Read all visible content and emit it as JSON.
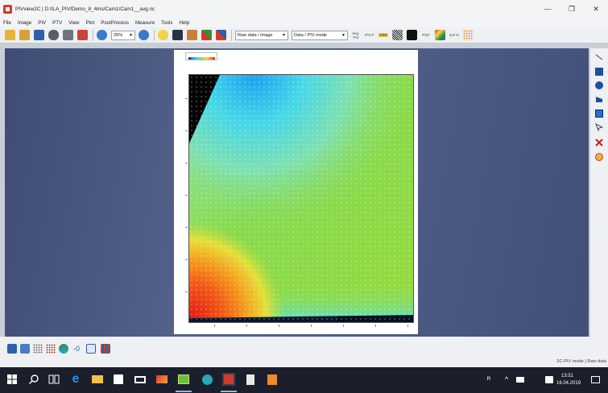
{
  "window": {
    "title": "PIVview2C | D:/ILA_PIV/Demo_8_4ms/Cam1/Cam1__avg.nc",
    "minimize": "—",
    "maximize": "❐",
    "close": "✕"
  },
  "menu": {
    "items": [
      "File",
      "Image",
      "PIV",
      "PTV",
      "View",
      "Plot",
      "PostProcess",
      "Measure",
      "Tools",
      "Help"
    ]
  },
  "toolbar": {
    "zoom_value": "25%",
    "display_mode": "Raw data / image",
    "data_mode": "Data / PIV mode",
    "img_pre_label": "Img-Pre",
    "pivf_label": "PIV-F",
    "cfg_label": "CFG",
    "pdf_label": "PDF",
    "zn_label": "Σu² N",
    "caret": "▼"
  },
  "status_bar": {
    "mode_text": "2C-PIV mode | Raw data"
  },
  "taskbar": {
    "time": "13:51",
    "date": "16.04.2019"
  }
}
